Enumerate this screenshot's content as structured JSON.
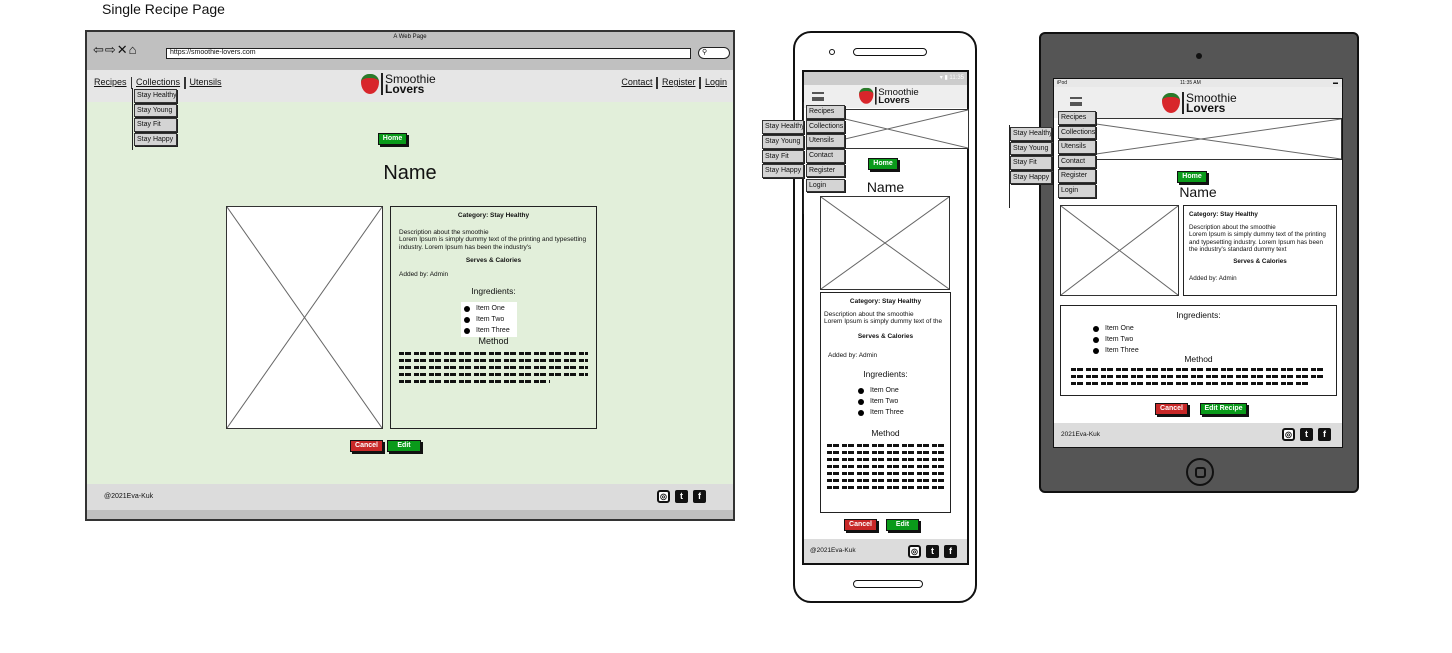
{
  "page_title": "Single Recipe Page",
  "browser": {
    "title": "A Web Page",
    "url": "https://smoothie-lovers.com"
  },
  "logo": {
    "line1": "Smoothie",
    "line2": "Lovers"
  },
  "nav": {
    "left": [
      "Recipes",
      "Collections",
      "Utensils"
    ],
    "right": [
      "Contact",
      "Register",
      "Login"
    ]
  },
  "mobile_menu": [
    "Recipes",
    "Collections",
    "Utensils",
    "Contact",
    "Register",
    "Login"
  ],
  "submenu": [
    "Stay Healthy",
    "Stay Young",
    "Stay Fit",
    "Stay Happy"
  ],
  "home_button": "Home",
  "recipe": {
    "name": "Name",
    "category": "Category: Stay Healthy",
    "description": "Description about the smoothie",
    "lorem_desktop": "Lorem Ipsum is simply dummy text of the printing and typesetting industry. Lorem Ipsum has been the industry's",
    "lorem_mobile": "Lorem Ipsum is simply dummy text of the",
    "lorem_tablet": "Lorem Ipsum is simply dummy text of the printing and typesetting industry. Lorem Ipsum has been the industry's standard dummy text",
    "serves": "Serves & Calories",
    "added_by": "Added by: Admin",
    "ingredients_heading": "Ingredients:",
    "ingredients": [
      "Item One",
      "Item Two",
      "Item Three"
    ],
    "method_heading": "Method"
  },
  "buttons": {
    "cancel": "Cancel",
    "edit": "Edit",
    "edit_recipe": "Edit Recipe"
  },
  "footer": {
    "copyright": "@2021Eva-Kuk",
    "copyright_tablet": "2021Eva-Kuk",
    "social": [
      "instagram-icon",
      "twitter-icon",
      "facebook-icon"
    ]
  },
  "phone_status": {
    "time": "11:35"
  },
  "tablet_status": {
    "device": "iPod",
    "time": "11:35 AM"
  },
  "colors": {
    "content_bg": "#e2efda",
    "green": "#0a9a1a",
    "red": "#c82828"
  }
}
